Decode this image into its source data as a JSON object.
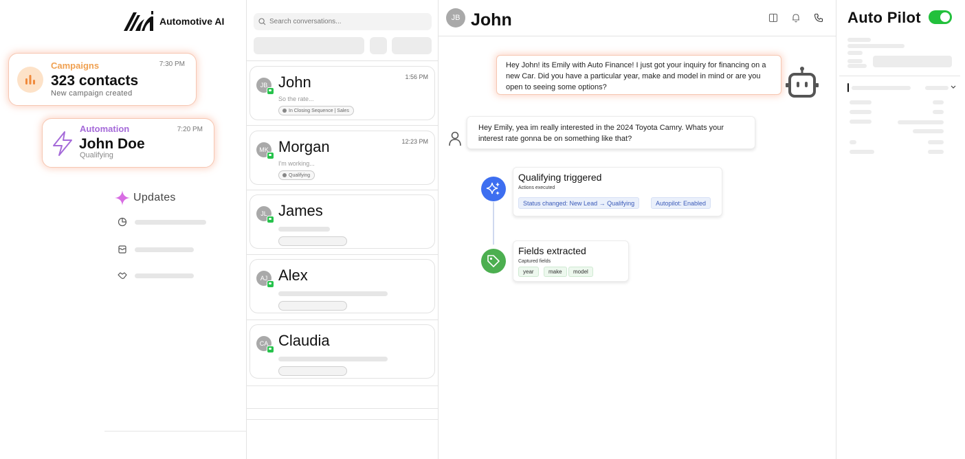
{
  "brand": {
    "name": "Automotive AI"
  },
  "cards": {
    "campaign": {
      "kicker": "Campaigns",
      "title": "323 contacts",
      "subtitle": "New campaign created",
      "time": "7:30 PM"
    },
    "automation": {
      "kicker": "Automation",
      "title": "John Doe",
      "subtitle": "Qualifying",
      "time": "7:20 PM"
    }
  },
  "updates": {
    "label": "Updates"
  },
  "search": {
    "placeholder": "Search conversations..."
  },
  "conversations": [
    {
      "initials": "JB",
      "name": "John",
      "time": "1:56 PM",
      "preview": "So the rate...",
      "tag": "In Closing Sequence | Sales"
    },
    {
      "initials": "MK",
      "name": "Morgan",
      "time": "12:23 PM",
      "preview": "I'm working...",
      "tag": "Qualifying"
    },
    {
      "initials": "JL",
      "name": "James"
    },
    {
      "initials": "AJ",
      "name": "Alex"
    },
    {
      "initials": "CA",
      "name": "Claudia"
    }
  ],
  "chat": {
    "initials": "JB",
    "name": "John",
    "ai_message": "Hey John! its Emily with Auto Finance! I just got your inquiry for financing on a new Car. Did you have a particular year, make and model in mind or are you open to seeing some options?",
    "user_message": "Hey Emily, yea im really interested in the 2024 Toyota Camry. Whats your interest rate gonna be on something like that?",
    "events": [
      {
        "title": "Qualifying triggered",
        "subtitle": "Actions executed",
        "pills": [
          "Status changed: New Lead → Qualifying",
          "Autopilot: Enabled"
        ],
        "color": "#3d6ef0"
      },
      {
        "title": "Fields extracted",
        "subtitle": "Captured fields",
        "pills": [
          "year",
          "make",
          "model"
        ],
        "color": "#4caf50"
      }
    ]
  },
  "autopilot": {
    "title": "Auto Pilot",
    "enabled": true
  },
  "colors": {
    "accent_orange": "#f0a050",
    "accent_purple": "#a56ad9",
    "toggle_green": "#22c03c"
  }
}
